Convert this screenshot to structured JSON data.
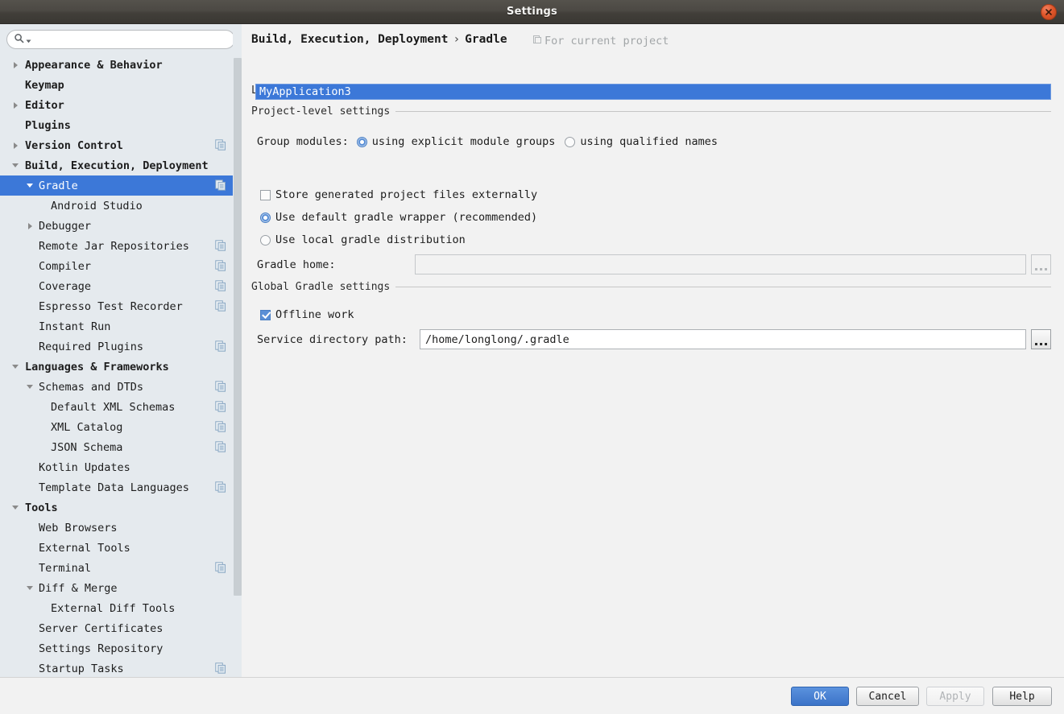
{
  "window": {
    "title": "Settings",
    "close_icon": "close-icon"
  },
  "sidebar": {
    "search": {
      "value": "",
      "placeholder": "",
      "icon": "search-icon"
    },
    "items": [
      {
        "label": "Appearance & Behavior",
        "level": 0,
        "twisty": "collapsed",
        "bold": true,
        "overlay": false,
        "selected": false
      },
      {
        "label": "Keymap",
        "level": 0,
        "twisty": "none",
        "bold": true,
        "overlay": false,
        "selected": false
      },
      {
        "label": "Editor",
        "level": 0,
        "twisty": "collapsed",
        "bold": true,
        "overlay": false,
        "selected": false
      },
      {
        "label": "Plugins",
        "level": 0,
        "twisty": "none",
        "bold": true,
        "overlay": false,
        "selected": false
      },
      {
        "label": "Version Control",
        "level": 0,
        "twisty": "collapsed",
        "bold": true,
        "overlay": true,
        "selected": false
      },
      {
        "label": "Build, Execution, Deployment",
        "level": 0,
        "twisty": "expanded",
        "bold": true,
        "overlay": false,
        "selected": false
      },
      {
        "label": "Gradle",
        "level": 1,
        "twisty": "expanded",
        "bold": false,
        "overlay": true,
        "selected": true
      },
      {
        "label": "Android Studio",
        "level": 2,
        "twisty": "none",
        "bold": false,
        "overlay": false,
        "selected": false
      },
      {
        "label": "Debugger",
        "level": 1,
        "twisty": "collapsed",
        "bold": false,
        "overlay": false,
        "selected": false
      },
      {
        "label": "Remote Jar Repositories",
        "level": 1,
        "twisty": "none",
        "bold": false,
        "overlay": true,
        "selected": false
      },
      {
        "label": "Compiler",
        "level": 1,
        "twisty": "none",
        "bold": false,
        "overlay": true,
        "selected": false
      },
      {
        "label": "Coverage",
        "level": 1,
        "twisty": "none",
        "bold": false,
        "overlay": true,
        "selected": false
      },
      {
        "label": "Espresso Test Recorder",
        "level": 1,
        "twisty": "none",
        "bold": false,
        "overlay": true,
        "selected": false
      },
      {
        "label": "Instant Run",
        "level": 1,
        "twisty": "none",
        "bold": false,
        "overlay": false,
        "selected": false
      },
      {
        "label": "Required Plugins",
        "level": 1,
        "twisty": "none",
        "bold": false,
        "overlay": true,
        "selected": false
      },
      {
        "label": "Languages & Frameworks",
        "level": 0,
        "twisty": "expanded",
        "bold": true,
        "overlay": false,
        "selected": false
      },
      {
        "label": "Schemas and DTDs",
        "level": 1,
        "twisty": "expanded",
        "bold": false,
        "overlay": true,
        "selected": false
      },
      {
        "label": "Default XML Schemas",
        "level": 2,
        "twisty": "none",
        "bold": false,
        "overlay": true,
        "selected": false
      },
      {
        "label": "XML Catalog",
        "level": 2,
        "twisty": "none",
        "bold": false,
        "overlay": true,
        "selected": false
      },
      {
        "label": "JSON Schema",
        "level": 2,
        "twisty": "none",
        "bold": false,
        "overlay": true,
        "selected": false
      },
      {
        "label": "Kotlin Updates",
        "level": 1,
        "twisty": "none",
        "bold": false,
        "overlay": false,
        "selected": false
      },
      {
        "label": "Template Data Languages",
        "level": 1,
        "twisty": "none",
        "bold": false,
        "overlay": true,
        "selected": false
      },
      {
        "label": "Tools",
        "level": 0,
        "twisty": "expanded",
        "bold": true,
        "overlay": false,
        "selected": false
      },
      {
        "label": "Web Browsers",
        "level": 1,
        "twisty": "none",
        "bold": false,
        "overlay": false,
        "selected": false
      },
      {
        "label": "External Tools",
        "level": 1,
        "twisty": "none",
        "bold": false,
        "overlay": false,
        "selected": false
      },
      {
        "label": "Terminal",
        "level": 1,
        "twisty": "none",
        "bold": false,
        "overlay": true,
        "selected": false
      },
      {
        "label": "Diff & Merge",
        "level": 1,
        "twisty": "expanded",
        "bold": false,
        "overlay": false,
        "selected": false
      },
      {
        "label": "External Diff Tools",
        "level": 2,
        "twisty": "none",
        "bold": false,
        "overlay": false,
        "selected": false
      },
      {
        "label": "Server Certificates",
        "level": 1,
        "twisty": "none",
        "bold": false,
        "overlay": false,
        "selected": false
      },
      {
        "label": "Settings Repository",
        "level": 1,
        "twisty": "none",
        "bold": false,
        "overlay": false,
        "selected": false
      },
      {
        "label": "Startup Tasks",
        "level": 1,
        "twisty": "none",
        "bold": false,
        "overlay": true,
        "selected": false
      }
    ]
  },
  "main": {
    "breadcrumb": {
      "root": "Build, Execution, Deployment",
      "separator": "›",
      "leaf": "Gradle"
    },
    "scope_label": "For current project",
    "scope_icon": "project-scope-icon",
    "sections": {
      "linked_projects": "Linked Gradle projects",
      "project_level": "Project-level settings",
      "global_settings": "Global Gradle settings"
    },
    "linked_projects": {
      "items": [
        "MyApplication3"
      ],
      "selected_index": 0
    },
    "group_modules": {
      "label": "Group modules:",
      "options": [
        {
          "label": "using explicit module groups",
          "selected": true
        },
        {
          "label": "using qualified names",
          "selected": false
        }
      ]
    },
    "store_externally": {
      "label": "Store generated project files externally",
      "checked": false
    },
    "distribution": {
      "options": [
        {
          "label": "Use default gradle wrapper (recommended)",
          "selected": true
        },
        {
          "label": "Use local gradle distribution",
          "selected": false
        }
      ]
    },
    "gradle_home": {
      "label": "Gradle home:",
      "value": "",
      "enabled": false,
      "browse_label": "..."
    },
    "offline_work": {
      "label": "Offline work",
      "checked": true
    },
    "service_dir": {
      "label": "Service directory path:",
      "value": "/home/longlong/.gradle",
      "enabled": true,
      "browse_label": "..."
    }
  },
  "footer": {
    "ok": "OK",
    "cancel": "Cancel",
    "apply": "Apply",
    "help": "Help"
  },
  "colors": {
    "accent": "#3c78d8",
    "titlebar": "#4c4944",
    "close": "#df5529",
    "sidebar_bg": "#e5eaee",
    "panel_bg": "#f2f2f2"
  }
}
